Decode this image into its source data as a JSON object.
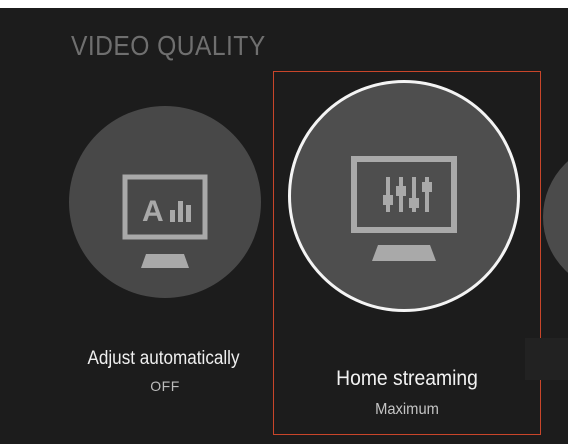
{
  "screen": {
    "title": "VIDEO QUALITY"
  },
  "options": [
    {
      "label": "Adjust automatically",
      "value": "OFF",
      "icon": "monitor-auto-quality-icon",
      "icon_text": "A",
      "selected": false
    },
    {
      "label": "Home streaming",
      "value": "Maximum",
      "icon": "monitor-equalizer-icon",
      "selected": true
    },
    {
      "label": "",
      "value": "",
      "icon": "",
      "selected": false
    }
  ],
  "colors": {
    "background": "#1c1c1c",
    "circle": "#4a4a4a",
    "selected_ring": "#f4f4f4",
    "focus_frame": "#c8452a",
    "title": "#6f6f6f",
    "icon": "#a9a9a9"
  }
}
